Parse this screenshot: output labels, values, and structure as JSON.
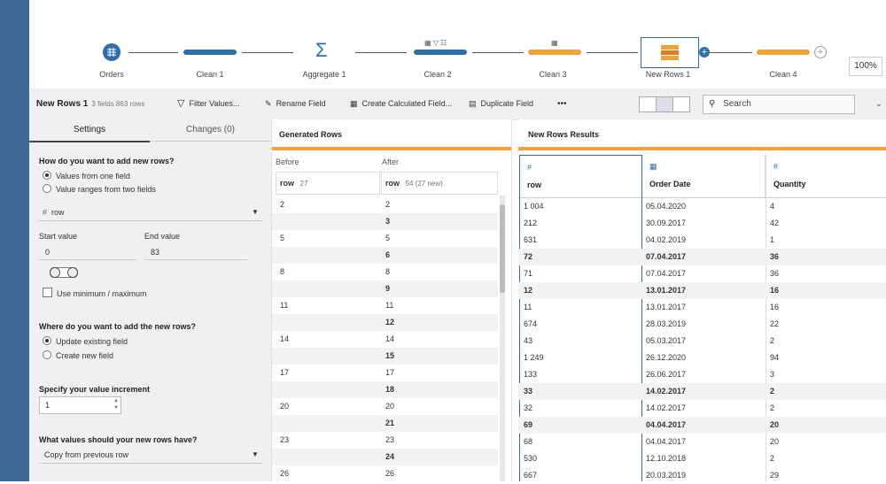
{
  "flow": {
    "nodes": [
      {
        "label": "Orders"
      },
      {
        "label": "Clean 1"
      },
      {
        "label": "Aggregate 1"
      },
      {
        "label": "Clean 2"
      },
      {
        "label": "Clean 3"
      },
      {
        "label": "New Rows 1"
      },
      {
        "label": "Clean 4"
      }
    ],
    "zoom": "100%",
    "colors": {
      "blue": "#2f6fa8",
      "orange": "#f0a33a",
      "sidebar": "#3d6a95"
    }
  },
  "toolbar": {
    "title": "New Rows 1",
    "subtitle": "3 fields  863 rows",
    "filter": "Filter Values...",
    "rename": "Rename Field",
    "calc": "Create Calculated Field...",
    "duplicate": "Duplicate Field",
    "more": "•••",
    "search_placeholder": "Search"
  },
  "settings": {
    "tab_settings": "Settings",
    "tab_changes": "Changes (0)",
    "q1": "How do you want to add new rows?",
    "opt_one_field": "Values from one field",
    "opt_two_fields": "Value ranges from two fields",
    "field_select": "row",
    "start_label": "Start value",
    "end_label": "End value",
    "start_value": "0",
    "end_value": "83",
    "use_minmax": "Use minimum / maximum",
    "q2": "Where do you want to add the new rows?",
    "opt_update": "Update existing field",
    "opt_create": "Create new field",
    "q3": "Specify your value increment",
    "increment": "1",
    "q4": "What values should your new rows have?",
    "values_select": "Copy from previous row"
  },
  "generated": {
    "title": "Generated Rows",
    "before_label": "Before",
    "after_label": "After",
    "before_col": "row",
    "before_count": "27",
    "after_col": "row",
    "after_count": "54 (27 new)",
    "rows": [
      {
        "before": "2",
        "after": "2",
        "new": false
      },
      {
        "before": "",
        "after": "3",
        "new": true
      },
      {
        "before": "5",
        "after": "5",
        "new": false
      },
      {
        "before": "",
        "after": "6",
        "new": true
      },
      {
        "before": "8",
        "after": "8",
        "new": false
      },
      {
        "before": "",
        "after": "9",
        "new": true
      },
      {
        "before": "11",
        "after": "11",
        "new": false
      },
      {
        "before": "",
        "after": "12",
        "new": true
      },
      {
        "before": "14",
        "after": "14",
        "new": false
      },
      {
        "before": "",
        "after": "15",
        "new": true
      },
      {
        "before": "17",
        "after": "17",
        "new": false
      },
      {
        "before": "",
        "after": "18",
        "new": true
      },
      {
        "before": "20",
        "after": "20",
        "new": false
      },
      {
        "before": "",
        "after": "21",
        "new": true
      },
      {
        "before": "23",
        "after": "23",
        "new": false
      },
      {
        "before": "",
        "after": "24",
        "new": true
      },
      {
        "before": "26",
        "after": "26",
        "new": false
      }
    ]
  },
  "results": {
    "title": "New Rows Results",
    "columns": [
      {
        "icon": "#",
        "name": "row"
      },
      {
        "icon": "calendar",
        "name": "Order Date"
      },
      {
        "icon": "#",
        "name": "Quantity"
      }
    ],
    "rows": [
      {
        "row": "1 004",
        "date": "05.04.2020",
        "qty": "4",
        "new": false
      },
      {
        "row": "212",
        "date": "30.09.2017",
        "qty": "42",
        "new": false
      },
      {
        "row": "631",
        "date": "04.02.2019",
        "qty": "1",
        "new": false
      },
      {
        "row": "72",
        "date": "07.04.2017",
        "qty": "36",
        "new": true
      },
      {
        "row": "71",
        "date": "07.04.2017",
        "qty": "36",
        "new": false
      },
      {
        "row": "12",
        "date": "13.01.2017",
        "qty": "16",
        "new": true
      },
      {
        "row": "11",
        "date": "13.01.2017",
        "qty": "16",
        "new": false
      },
      {
        "row": "674",
        "date": "28.03.2019",
        "qty": "22",
        "new": false
      },
      {
        "row": "43",
        "date": "05.03.2017",
        "qty": "2",
        "new": false
      },
      {
        "row": "1 249",
        "date": "26.12.2020",
        "qty": "94",
        "new": false
      },
      {
        "row": "133",
        "date": "26.06.2017",
        "qty": "3",
        "new": false
      },
      {
        "row": "33",
        "date": "14.02.2017",
        "qty": "2",
        "new": true
      },
      {
        "row": "32",
        "date": "14.02.2017",
        "qty": "2",
        "new": false
      },
      {
        "row": "69",
        "date": "04.04.2017",
        "qty": "20",
        "new": true
      },
      {
        "row": "68",
        "date": "04.04.2017",
        "qty": "20",
        "new": false
      },
      {
        "row": "530",
        "date": "12.10.2018",
        "qty": "2",
        "new": false
      },
      {
        "row": "667",
        "date": "20.03.2019",
        "qty": "29",
        "new": false
      }
    ]
  }
}
